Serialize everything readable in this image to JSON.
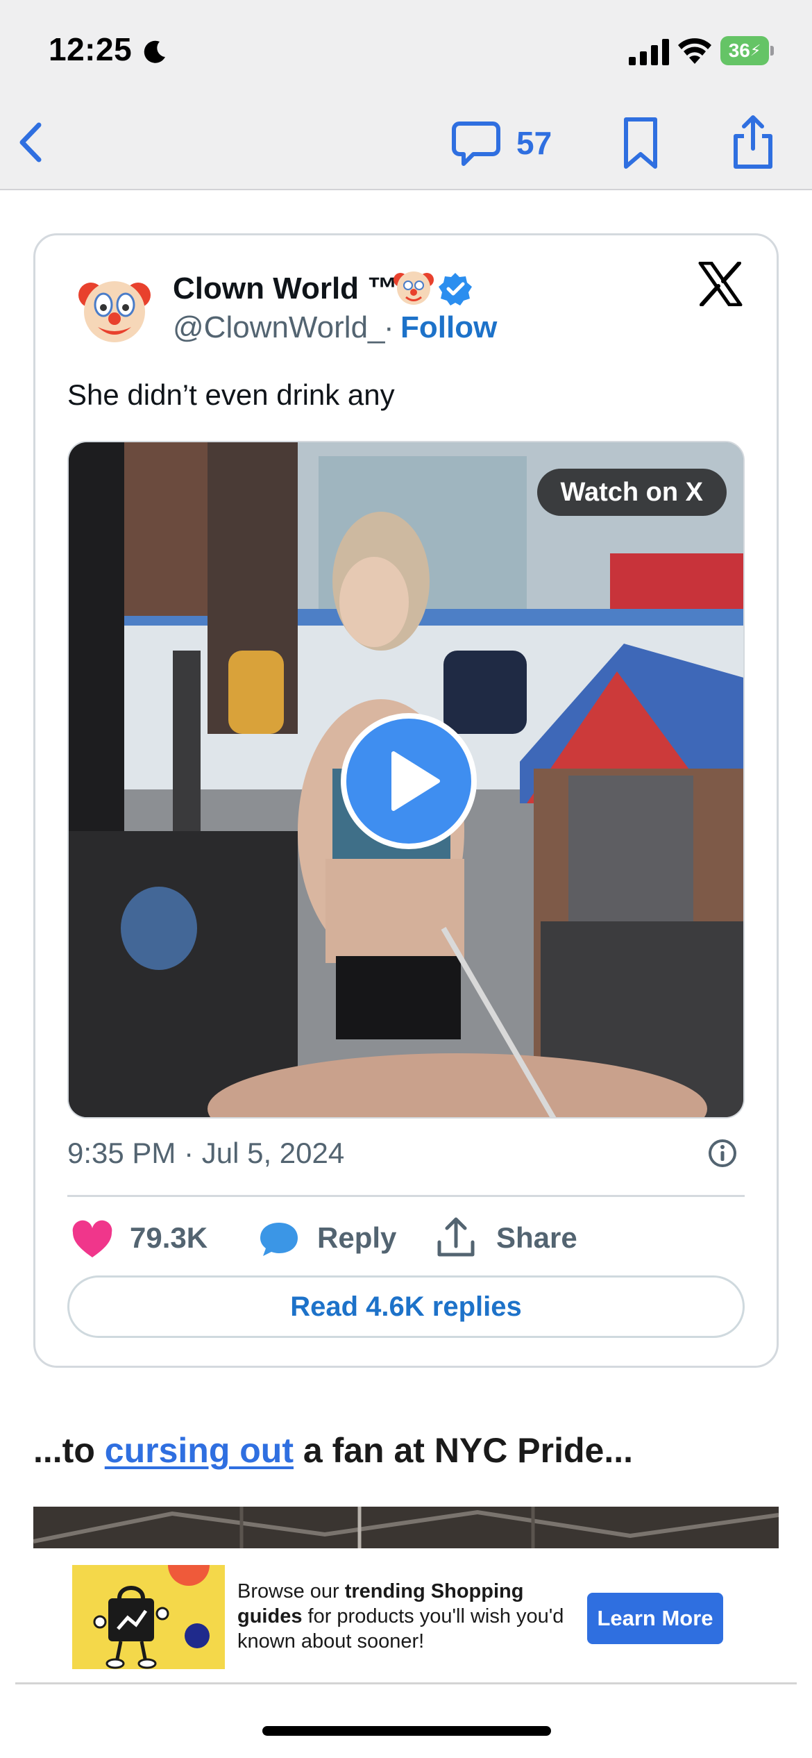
{
  "status_bar": {
    "time": "12:25",
    "battery": "36"
  },
  "nav": {
    "comment_count": "57"
  },
  "tweet": {
    "author_name": "Clown World ™",
    "handle": "@ClownWorld_",
    "separator": "·",
    "follow_label": "Follow",
    "text": "She didn’t even drink any",
    "watch_label": "Watch on X",
    "timestamp": "9:35 PM · Jul 5, 2024",
    "like_count": "79.3K",
    "reply_label": "Reply",
    "share_label": "Share",
    "read_replies_label": "Read 4.6K replies",
    "colors": {
      "like": "#f0368b",
      "reply": "#3b96e6",
      "link": "#1d72c9",
      "verified": "#2b8eef"
    }
  },
  "article": {
    "prefix": "...to ",
    "link_text": "cursing out",
    "suffix": " a fan at NYC Pride..."
  },
  "ad": {
    "text_pre": "Browse our ",
    "text_bold": "trending Shopping guides",
    "text_post": " for products you'll wish you'd known about sooner!",
    "cta_label": "Learn More"
  }
}
